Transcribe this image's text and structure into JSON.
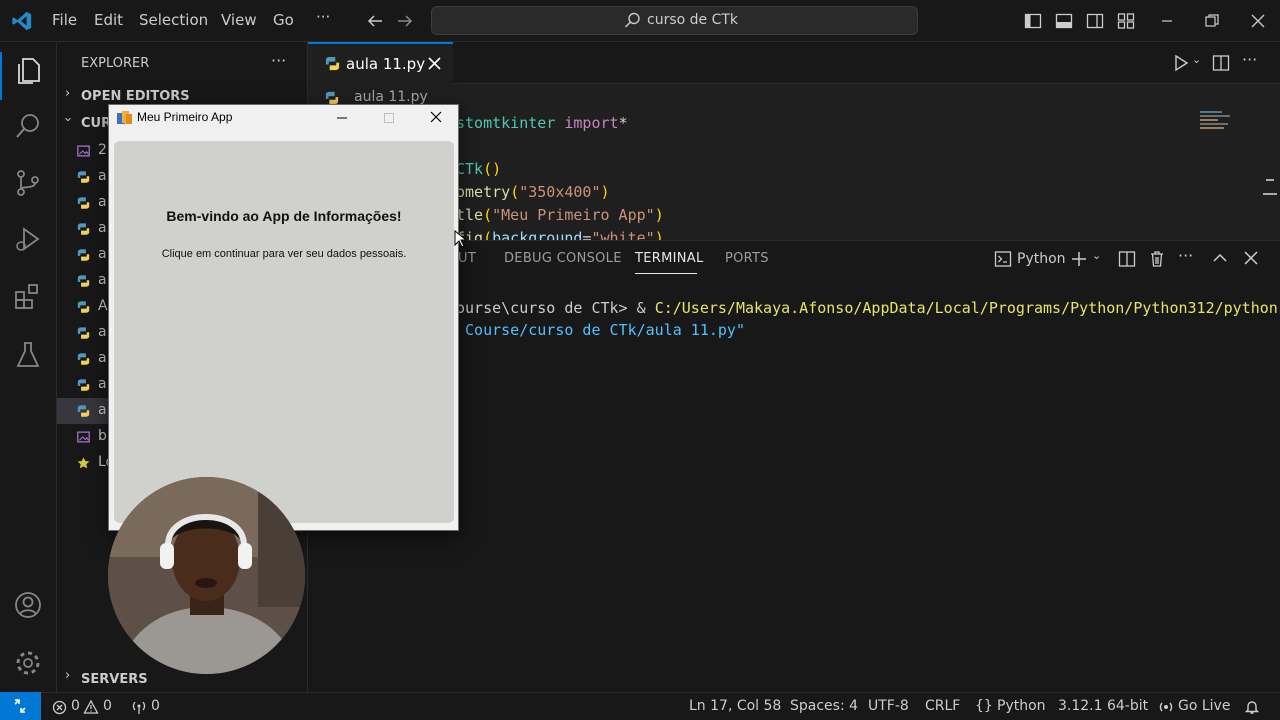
{
  "titlebar": {
    "menus": [
      "File",
      "Edit",
      "Selection",
      "View",
      "Go",
      "···"
    ],
    "search_text": "curso de CTk"
  },
  "sidebar": {
    "title": "EXPLORER",
    "more": "···",
    "open_editors": "OPEN EDITORS",
    "folder": "CUR",
    "files": [
      {
        "label": "2",
        "icon": "image-file-icon"
      },
      {
        "label": "a",
        "icon": "python-file-icon"
      },
      {
        "label": "a",
        "icon": "python-file-icon"
      },
      {
        "label": "a",
        "icon": "python-file-icon"
      },
      {
        "label": "a",
        "icon": "python-file-icon"
      },
      {
        "label": "a",
        "icon": "python-file-icon"
      },
      {
        "label": "A",
        "icon": "python-file-icon"
      },
      {
        "label": "a",
        "icon": "python-file-icon"
      },
      {
        "label": "a",
        "icon": "python-file-icon"
      },
      {
        "label": "a",
        "icon": "python-file-icon"
      },
      {
        "label": "a",
        "icon": "python-file-icon"
      },
      {
        "label": "b",
        "icon": "image-file-icon"
      },
      {
        "label": "Lo",
        "icon": "star-icon"
      }
    ],
    "servers": "SERVERS"
  },
  "editor": {
    "tab_label": "aula 11.py",
    "breadcrumb": "aula 11.py",
    "code_lines": [
      {
        "parts": [
          {
            "t": "stomtkinter ",
            "c": "#4ec9b0"
          },
          {
            "t": "import",
            "c": "#c586c0"
          },
          {
            "t": "*",
            "c": "#d4d4d4"
          }
        ]
      },
      {
        "parts": []
      },
      {
        "parts": [
          {
            "t": "CTk",
            "c": "#4ec9b0"
          },
          {
            "t": "()",
            "c": "#ffd700"
          }
        ]
      },
      {
        "parts": [
          {
            "t": "ometry",
            "c": "#dcdcaa"
          },
          {
            "t": "(",
            "c": "#ffd700"
          },
          {
            "t": "\"350x400\"",
            "c": "#ce9178"
          },
          {
            "t": ")",
            "c": "#ffd700"
          }
        ]
      },
      {
        "parts": [
          {
            "t": "tle",
            "c": "#dcdcaa"
          },
          {
            "t": "(",
            "c": "#ffd700"
          },
          {
            "t": "\"Meu Primeiro App\"",
            "c": "#ce9178"
          },
          {
            "t": ")",
            "c": "#ffd700"
          }
        ]
      },
      {
        "parts": [
          {
            "t": "fig",
            "c": "#dcdcaa"
          },
          {
            "t": "(",
            "c": "#ffd700"
          },
          {
            "t": "background",
            "c": "#9cdcfe"
          },
          {
            "t": "=",
            "c": "#d4d4d4"
          },
          {
            "t": "\"white\"",
            "c": "#ce9178"
          },
          {
            "t": ")",
            "c": "#ffd700"
          }
        ]
      }
    ]
  },
  "panel": {
    "tabs": [
      "UT",
      "DEBUG CONSOLE",
      "TERMINAL",
      "PORTS"
    ],
    "active_tab": "TERMINAL",
    "shell_label": "Python",
    "terminal": {
      "line1_prompt": "ourse\\curso de CTk> & ",
      "line1_cmd": "C:/Users/Makaya.Afonso/AppData/Local/Programs/Python/Python312/python.",
      "line2": " Course/curso de CTk/aula 11.py\""
    }
  },
  "app_window": {
    "title": "Meu Primeiro App",
    "heading": "Bem-vindo ao App de Informações!",
    "subtext": "Clique em continuar para ver seu dados pessoais."
  },
  "status": {
    "errors": "0",
    "warnings": "0",
    "ports": "0",
    "position": "Ln 17, Col 58",
    "spaces": "Spaces: 4",
    "encoding": "UTF-8",
    "eol": "CRLF",
    "language": "Python",
    "interpreter": "3.12.1 64-bit",
    "golive": "Go Live"
  },
  "colors": {
    "accent": "#0078d4",
    "python_yellow": "#f1d25a",
    "python_blue": "#519aba"
  }
}
